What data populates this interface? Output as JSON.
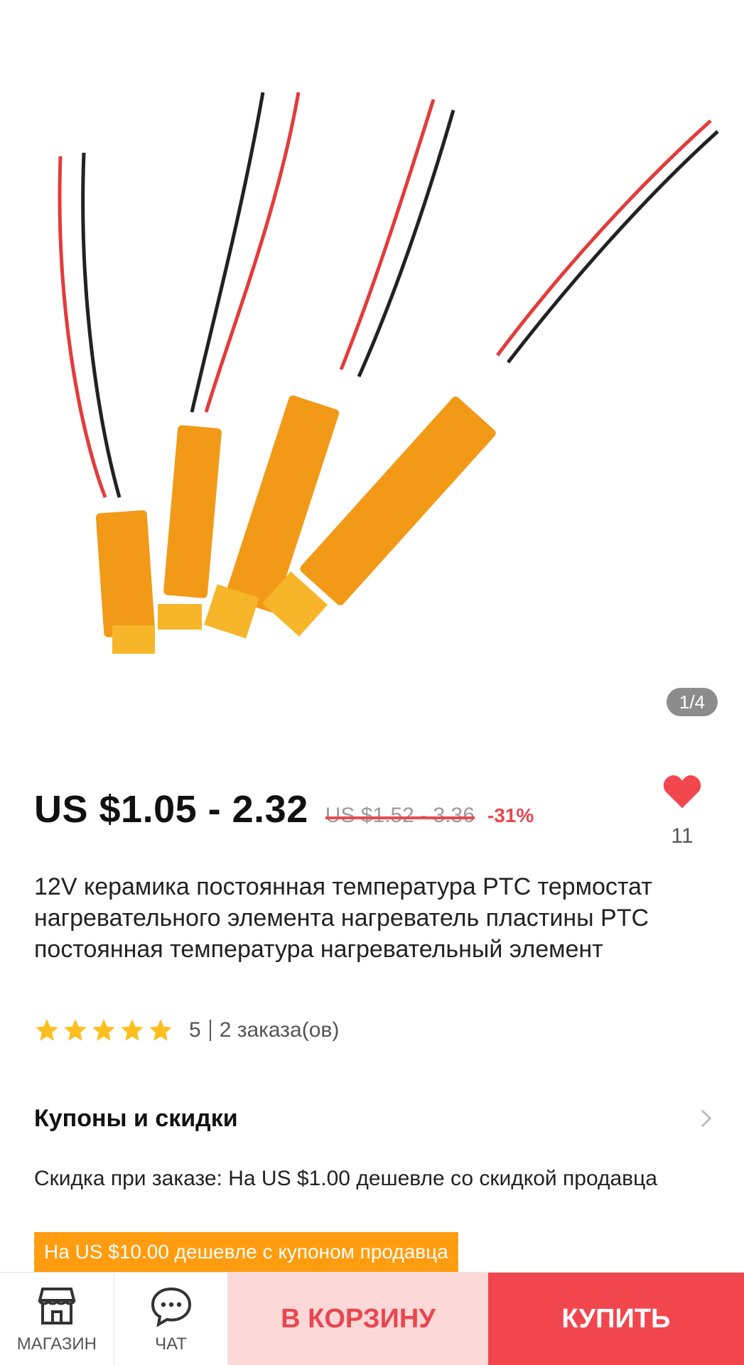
{
  "gallery": {
    "counter": "1/4",
    "image_description": "four orange PTC heating elements with red and black wires"
  },
  "product": {
    "price": "US $1.05 - 2.32",
    "old_price": "US $1.52 - 3.36",
    "discount": "-31%",
    "favorites_count": "11",
    "title": "12V керамика постоянная температура PTC термостат нагревательного элемента нагреватель пластины PTC постоянная температура нагревательный элемент",
    "rating_value": "5",
    "orders": "2 заказа(ов)",
    "rating_stars": 5
  },
  "coupons": {
    "section_title": "Купоны и скидки",
    "order_discount": "Скидка при заказе: На US $1.00 дешевле со скидкой продавца",
    "coupon_label": "На US $10.00 дешевле с купоном продавца"
  },
  "bottom_bar": {
    "store_label": "МАГАЗИН",
    "chat_label": "ЧАТ",
    "cart_label": "В КОРЗИНУ",
    "buy_label": "КУПИТЬ"
  },
  "colors": {
    "accent_red": "#f2464e",
    "cart_bg": "#fdd8d8",
    "coupon_orange": "#ff9c0f",
    "star_yellow": "#fcbf1e"
  }
}
